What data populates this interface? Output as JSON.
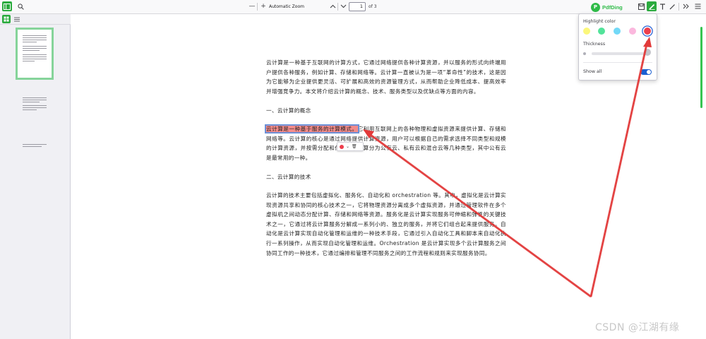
{
  "toolbar": {
    "zoom_value": "Automatic Zoom",
    "zoom_minus": "—",
    "zoom_plus": "+",
    "page_current": "1",
    "page_of": "of 3",
    "brand_name": "PdfDing",
    "brand_logo": "P"
  },
  "doc": {
    "p1": "云计算是一种基于互联网的计算方式，它通过网络提供各种计算资源，并以服务的形式向终端用户提供各种服务，例如计算、存储和网络等。云计算一直被认为是一项“革命性”的技术，这是因为它能够为企业提供更灵活、可扩展和高效的资源管理方式，从而帮助企业降低成本、提高效率并增强竞争力。本文将介绍云计算的概念、技术、服务类型以及优缺点等方面的内容。",
    "h1": "一、云计算的概念",
    "p2_highlight": "云计算是一种基于服务的计算模式。",
    "p2_rest": "它利用互联网上的各种物理和虚拟资源来提供计算、存储和网络等。云计算的核心是通过网络提供计算资源，用户可以根据自己的需求选择不同类型和规模的计算资源，并按需分配和付费。云计算分为公有云、私有云和混合云等几种类型，其中公有云是最常用的一种。",
    "h2": "二、云计算的技术",
    "p3": "云计算的技术主要包括虚拟化、服务化、自动化和 orchestration 等。其中，虚拟化是云计算实现资源共享和协同的核心技术之一，它将物理资源分离成多个虚拟资源，并通过管理软件在多个虚拟机之间动态分配计算、存储和网络等资源。服务化是云计算实现服务可伸缩和弹性的关键技术之一，它通过将云计算服务分解成一系列小的、独立的服务，并将它们组合起来提供服务。自动化是云计算实现自动化管理和运维的一种技术手段，它通过引入自动化工具和脚本来自动化执行一系列操作，从而实现自动化管理和运维。Orchestration 是云计算实现多个云计算服务之间协同工作的一种技术，它通过编排和管理不同服务之间的工作流程和规则来实现服务协同。"
  },
  "panel": {
    "highlight_color_label": "Highlight color",
    "thickness_label": "Thickness",
    "show_all_label": "Show all",
    "show_all_enabled": true,
    "colors": [
      "#fbf77b",
      "#52e39a",
      "#72d9f7",
      "#fbb8de",
      "#ee3f4d"
    ],
    "selected_color": "#ee3f4d"
  },
  "accent_color": "#2bab3e",
  "watermark": "CSDN @江湖有缘"
}
